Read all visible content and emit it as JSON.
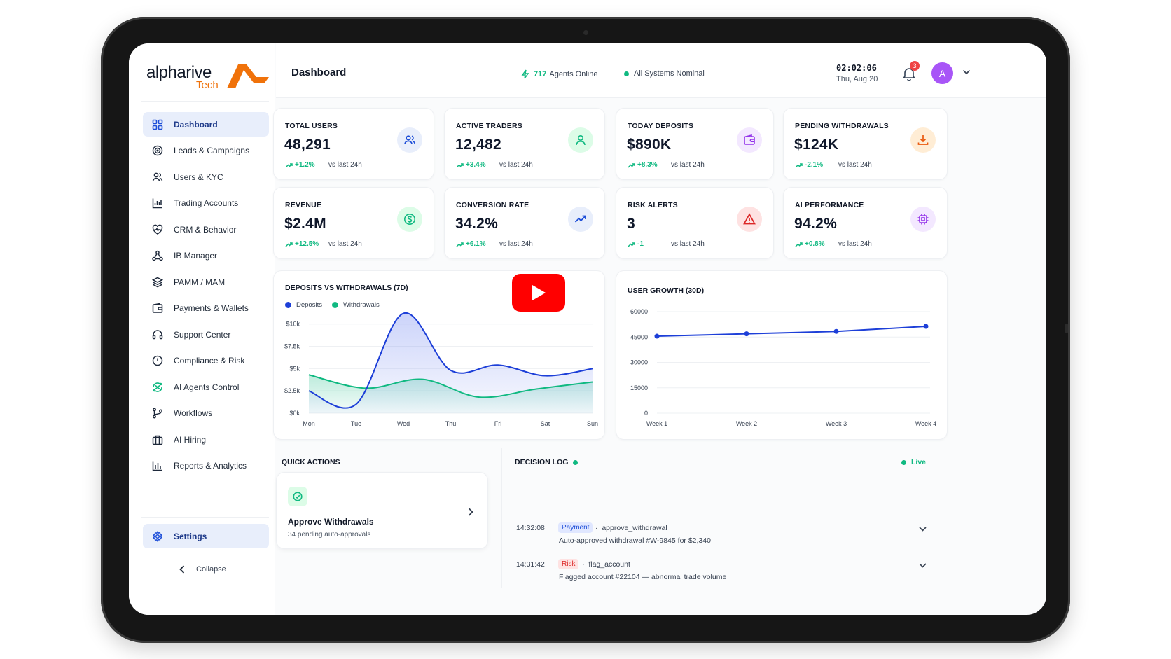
{
  "brand": {
    "name": "alpharive",
    "sub": "Tech",
    "accent": "#f0720a"
  },
  "header": {
    "title": "Dashboard",
    "agents_count": "717",
    "agents_label": "Agents Online",
    "system_status": "All Systems Nominal",
    "time": "02:02:06",
    "date": "Thu, Aug 20",
    "notifications": "3",
    "avatar_initial": "A"
  },
  "sidebar": {
    "items": [
      {
        "label": "Dashboard",
        "icon": "grid-icon"
      },
      {
        "label": "Leads & Campaigns",
        "icon": "target-icon"
      },
      {
        "label": "Users & KYC",
        "icon": "users-icon"
      },
      {
        "label": "Trading Accounts",
        "icon": "chart-icon"
      },
      {
        "label": "CRM & Behavior",
        "icon": "heart-icon"
      },
      {
        "label": "IB Manager",
        "icon": "network-icon"
      },
      {
        "label": "PAMM / MAM",
        "icon": "layers-icon"
      },
      {
        "label": "Payments & Wallets",
        "icon": "wallet-icon"
      },
      {
        "label": "Support Center",
        "icon": "headset-icon"
      },
      {
        "label": "Compliance & Risk",
        "icon": "shield-icon"
      },
      {
        "label": "AI Agents Control",
        "icon": "ai-icon"
      },
      {
        "label": "Workflows",
        "icon": "branch-icon"
      },
      {
        "label": "AI Hiring",
        "icon": "briefcase-icon"
      },
      {
        "label": "Reports & Analytics",
        "icon": "bar-chart-icon"
      }
    ],
    "settings": "Settings",
    "collapse": "Collapse"
  },
  "stats": [
    {
      "label": "TOTAL USERS",
      "value": "48,291",
      "change": "+1.2%",
      "vs": "vs last 24h",
      "icon": "users-icon",
      "color": "#1d4ed8",
      "bg": "#e8eefb"
    },
    {
      "label": "ACTIVE TRADERS",
      "value": "12,482",
      "change": "+3.4%",
      "vs": "vs last 24h",
      "icon": "user-icon",
      "color": "#10b981",
      "bg": "#dcfce7"
    },
    {
      "label": "TODAY DEPOSITS",
      "value": "$890K",
      "change": "+8.3%",
      "vs": "vs last 24h",
      "icon": "wallet-icon",
      "color": "#9333ea",
      "bg": "#f3e8ff"
    },
    {
      "label": "PENDING WITHDRAWALS",
      "value": "$124K",
      "change": "-2.1%",
      "vs": "vs last 24h",
      "icon": "download-icon",
      "color": "#ea580c",
      "bg": "#ffedd5"
    },
    {
      "label": "REVENUE",
      "value": "$2.4M",
      "change": "+12.5%",
      "vs": "vs last 24h",
      "icon": "dollar-icon",
      "color": "#10b981",
      "bg": "#dcfce7"
    },
    {
      "label": "CONVERSION RATE",
      "value": "34.2%",
      "change": "+6.1%",
      "vs": "vs last 24h",
      "icon": "trend-icon",
      "color": "#1d4ed8",
      "bg": "#e8eefb"
    },
    {
      "label": "RISK ALERTS",
      "value": "3",
      "change": "-1",
      "vs": "vs last 24h",
      "icon": "alert-icon",
      "color": "#dc2626",
      "bg": "#fee2e2"
    },
    {
      "label": "AI PERFORMANCE",
      "value": "94.2%",
      "change": "+0.8%",
      "vs": "vs last 24h",
      "icon": "cpu-icon",
      "color": "#9333ea",
      "bg": "#f3e8ff"
    }
  ],
  "chart_data": [
    {
      "type": "area",
      "title": "DEPOSITS VS WITHDRAWALS (7D)",
      "categories": [
        "Mon",
        "Tue",
        "Wed",
        "Thu",
        "Fri",
        "Sat",
        "Sun"
      ],
      "y_ticks": [
        "$0k",
        "$2.5k",
        "$5k",
        "$7.5k",
        "$10k"
      ],
      "ylim": [
        0,
        11000
      ],
      "series": [
        {
          "name": "Deposits",
          "color": "#1d3fd8",
          "values": [
            2500,
            1000,
            11200,
            4800,
            5400,
            4200,
            5000
          ]
        },
        {
          "name": "Withdrawals",
          "color": "#10b981",
          "values": [
            4300,
            2800,
            3800,
            1800,
            2700,
            3500
          ]
        }
      ],
      "grid": true,
      "legend": "top-left"
    },
    {
      "type": "line",
      "title": "USER GROWTH (30D)",
      "categories": [
        "Week 1",
        "Week 2",
        "Week 3",
        "Week 4"
      ],
      "y_ticks": [
        "0",
        "15000",
        "30000",
        "45000",
        "60000"
      ],
      "ylim": [
        0,
        60000
      ],
      "series": [
        {
          "name": "",
          "color": "#1d3fd8",
          "values": [
            45500,
            46900,
            48300,
            51300
          ]
        }
      ],
      "grid": true
    }
  ],
  "quick_actions": {
    "title": "QUICK ACTIONS",
    "item": {
      "name": "Approve Withdrawals",
      "sub": "34 pending auto-approvals"
    }
  },
  "decision_log": {
    "title": "DECISION LOG",
    "live": "Live",
    "entries": [
      {
        "time": "14:32:08",
        "tag": "Payment",
        "action": "approve_withdrawal",
        "desc": "Auto-approved withdrawal #W-9845 for $2,340",
        "tag_color": "#1d4ed8",
        "tag_bg": "#e0e7ff"
      },
      {
        "time": "14:31:42",
        "tag": "Risk",
        "action": "flag_account",
        "desc": "Flagged account #22104 — abnormal trade volume",
        "tag_color": "#dc2626",
        "tag_bg": "#fee2e2"
      }
    ]
  }
}
